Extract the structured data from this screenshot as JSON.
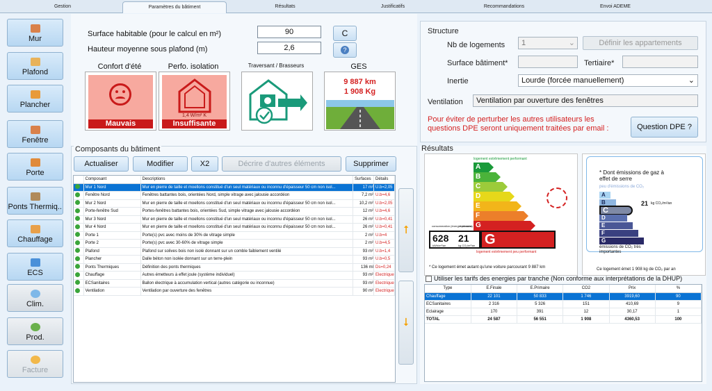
{
  "tabs": [
    "Gestion",
    "Paramètres du bâtiment",
    "Résultats",
    "Justificatifs",
    "Recommandations",
    "Envoi ADEME"
  ],
  "nav": [
    "Mur",
    "Plafond",
    "Plancher",
    "Fenêtre",
    "Porte",
    "Ponts Thermiq...",
    "Chauffage",
    "ECS",
    "Clim.",
    "Prod.",
    "Facture"
  ],
  "params": {
    "surface_label": "Surface habitable (pour le calcul en m²)",
    "surface_value": "90",
    "hauteur_label": "Hauteur moyenne sous plafond (m)",
    "hauteur_value": "2,6",
    "c_button": "C",
    "info_button": "?"
  },
  "cards": {
    "confort_title": "Confort d'été",
    "confort_status": "Mauvais",
    "isolation_title": "Perfo. isolation",
    "isolation_value": "1,4 W/m² K",
    "isolation_status": "Insuffisante",
    "traversant_title": "Traversant / Brasseurs",
    "ges_title": "GES",
    "ges_km": "9 887 km",
    "ges_kg": "1 908 Kg"
  },
  "structure": {
    "title": "Structure",
    "nb_logements_label": "Nb de logements",
    "nb_logements_value": "1",
    "definir_button": "Définir les appartements",
    "surface_batiment_label": "Surface bâtiment*",
    "tertiaire_label": "Tertiaire*",
    "inertie_label": "Inertie",
    "inertie_value": "Lourde (forcée manuellement)",
    "ventilation_label": "Ventilation",
    "ventilation_value": "Ventilation par ouverture des fenêtres",
    "warning": "Pour éviter de perturber les autres utilisateurs les questions DPE seront uniquement traitées par email :",
    "question_button": "Question DPE ?"
  },
  "composants": {
    "title": "Composants du bâtiment",
    "buttons": {
      "actualiser": "Actualiser",
      "modifier": "Modifier",
      "x2": "X2",
      "decrire": "Décrire d'autres éléments",
      "supprimer": "Supprimer"
    },
    "headers": [
      "",
      "Composant",
      "Descriptions",
      "Surfaces",
      "Détails"
    ],
    "rows": [
      [
        "Mur 1 Nord",
        "Mur en pierre de taille et moellons constitué d'un seul matériaux ou inconnu d'épaisseur 50 cm non isol...",
        "17 m²",
        "U.b=2,05"
      ],
      [
        "Fenêtre Nord",
        "Fenêtres battantes bois, orientées Nord, simple vitrage avec jalousie accordéon",
        "7,2 m²",
        "U.b=4,6"
      ],
      [
        "Mur 2 Nord",
        "Mur en pierre de taille et moellons constitué d'un seul matériaux ou inconnu d'épaisseur 50 cm non isol...",
        "10,2 m²",
        "U.b=2,05"
      ],
      [
        "Porte-fenêtre Sud",
        "Portes-fenêtres battantes bois, orientées Sud, simple vitrage avec jalousie accordéon",
        "12 m²",
        "U.b=4,6"
      ],
      [
        "Mur 3 Nord",
        "Mur en pierre de taille et moellons constitué d'un seul matériaux ou inconnu d'épaisseur 50 cm non isol...",
        "26 m²",
        "U.b=0,41"
      ],
      [
        "Mur 4 Nord",
        "Mur en pierre de taille et moellons constitué d'un seul matériaux ou inconnu d'épaisseur 50 cm non isol...",
        "26 m²",
        "U.b=0,41"
      ],
      [
        "Porte 1",
        "Porte(s) pvc avec moins de 30% de vitrage simple",
        "2 m²",
        "U.b=4"
      ],
      [
        "Porte 2",
        "Porte(s) pvc avec 30-60% de vitrage simple",
        "2 m²",
        "U.b=4,5"
      ],
      [
        "Plafond",
        "Plafond sur solives bois non isolé donnant sur un comble faiblement ventilé",
        "93 m²",
        "U.b=1,4"
      ],
      [
        "Plancher",
        "Dalle béton non isolée donnant sur un terre-plein",
        "93 m²",
        "U.b=0,5"
      ],
      [
        "Ponts Thermiques",
        "Définition des ponts thermiques",
        "136 ml",
        "Ds=0,24"
      ],
      [
        "Chauffage",
        "Autres émetteurs à effet joule (système individuel)",
        "93 m²",
        "Electrique"
      ],
      [
        "ECSanitaires",
        "Ballon électrique à accumulation vertical (autres catégorie ou inconnue)",
        "93 m²",
        "Electrique"
      ],
      [
        "Ventilation",
        "Ventilation par ouverture des fenêtres",
        "90 m²",
        "Electrique"
      ]
    ]
  },
  "resultats": {
    "title": "Résultats",
    "dpe_top": "logement extrêmement performant",
    "dpe_bottom": "logement extrêmement peu performant",
    "dpe_conso": "628",
    "dpe_conso_unit": "kWh/m²/an",
    "dpe_conso_label": "consommation (énergie primaire)",
    "dpe_emission": "21",
    "dpe_emission_unit": "kg CO₂/m²/an",
    "dpe_emission_label": "émissions",
    "dpe_class": "G",
    "dpe_note": "* Ce logement émet autant qu'une voiture parcourant 9 887 km",
    "ges_heading": "* Dont émissions de gaz à effet de serre",
    "ges_top": "peu d'émissions de CO₂",
    "ges_bottom": "émissions de CO₂ très importantes",
    "ges_value": "21",
    "ges_unit": "kg CO₂/m²/an",
    "ges_class": "C",
    "ges_note": "Ce logement émet 1 908 kg de CO₂ par an",
    "tarif_label": "Utiliser les tarifs des energies par tranche (Non conforme aux interprétations de la DHUP)",
    "table_headers": [
      "Type",
      "E.Finale",
      "E.Primaire",
      "CO2",
      "Prix",
      "%"
    ],
    "table_rows": [
      [
        "Chauffage",
        "22 101",
        "50 833",
        "1 746",
        "3919,60",
        "90"
      ],
      [
        "ECSanitaires",
        "2 316",
        "5 326",
        "151",
        "410,69",
        "9"
      ],
      [
        "Eclairage",
        "170",
        "391",
        "12",
        "30,17",
        "1"
      ],
      [
        "TOTAL",
        "24 587",
        "56 551",
        "1 908",
        "4360,53",
        "100"
      ]
    ]
  },
  "dpe_letters": [
    "A",
    "B",
    "C",
    "D",
    "E",
    "F",
    "G"
  ],
  "ges_letters": [
    "A",
    "B",
    "C",
    "D",
    "E",
    "F",
    "G"
  ],
  "colors": {
    "selection": "#0a73d4",
    "accent": "#d42121"
  }
}
